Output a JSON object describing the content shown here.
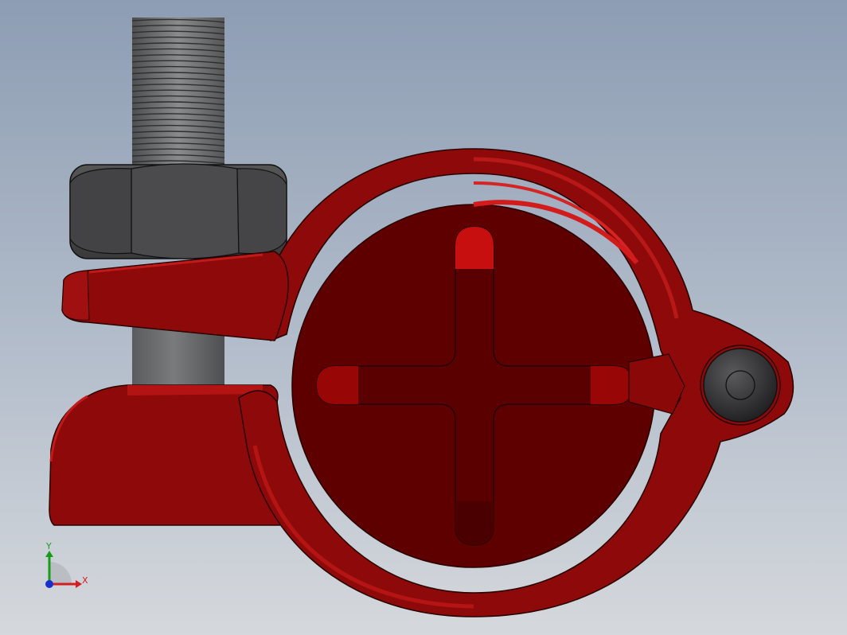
{
  "view": {
    "background_top": "#8d9db3",
    "background_bottom": "#d5d8dc"
  },
  "model": {
    "parts": [
      "threaded-rod",
      "hex-nut",
      "upper-clamp-arm",
      "lower-clamp-jaw",
      "clamp-ring",
      "cross-disc",
      "hinge-pin"
    ],
    "colors": {
      "clamp_red": "#8e0a0a",
      "clamp_dark": "#5e0000",
      "highlight_red": "#c41616",
      "steel_dark": "#4a4a4c",
      "steel_mid": "#6b6c6e"
    }
  },
  "triad": {
    "x_label": "X",
    "y_label": "Y",
    "x_color": "#d02020",
    "y_color": "#1a9a1a",
    "z_color": "#1a2fd0"
  }
}
